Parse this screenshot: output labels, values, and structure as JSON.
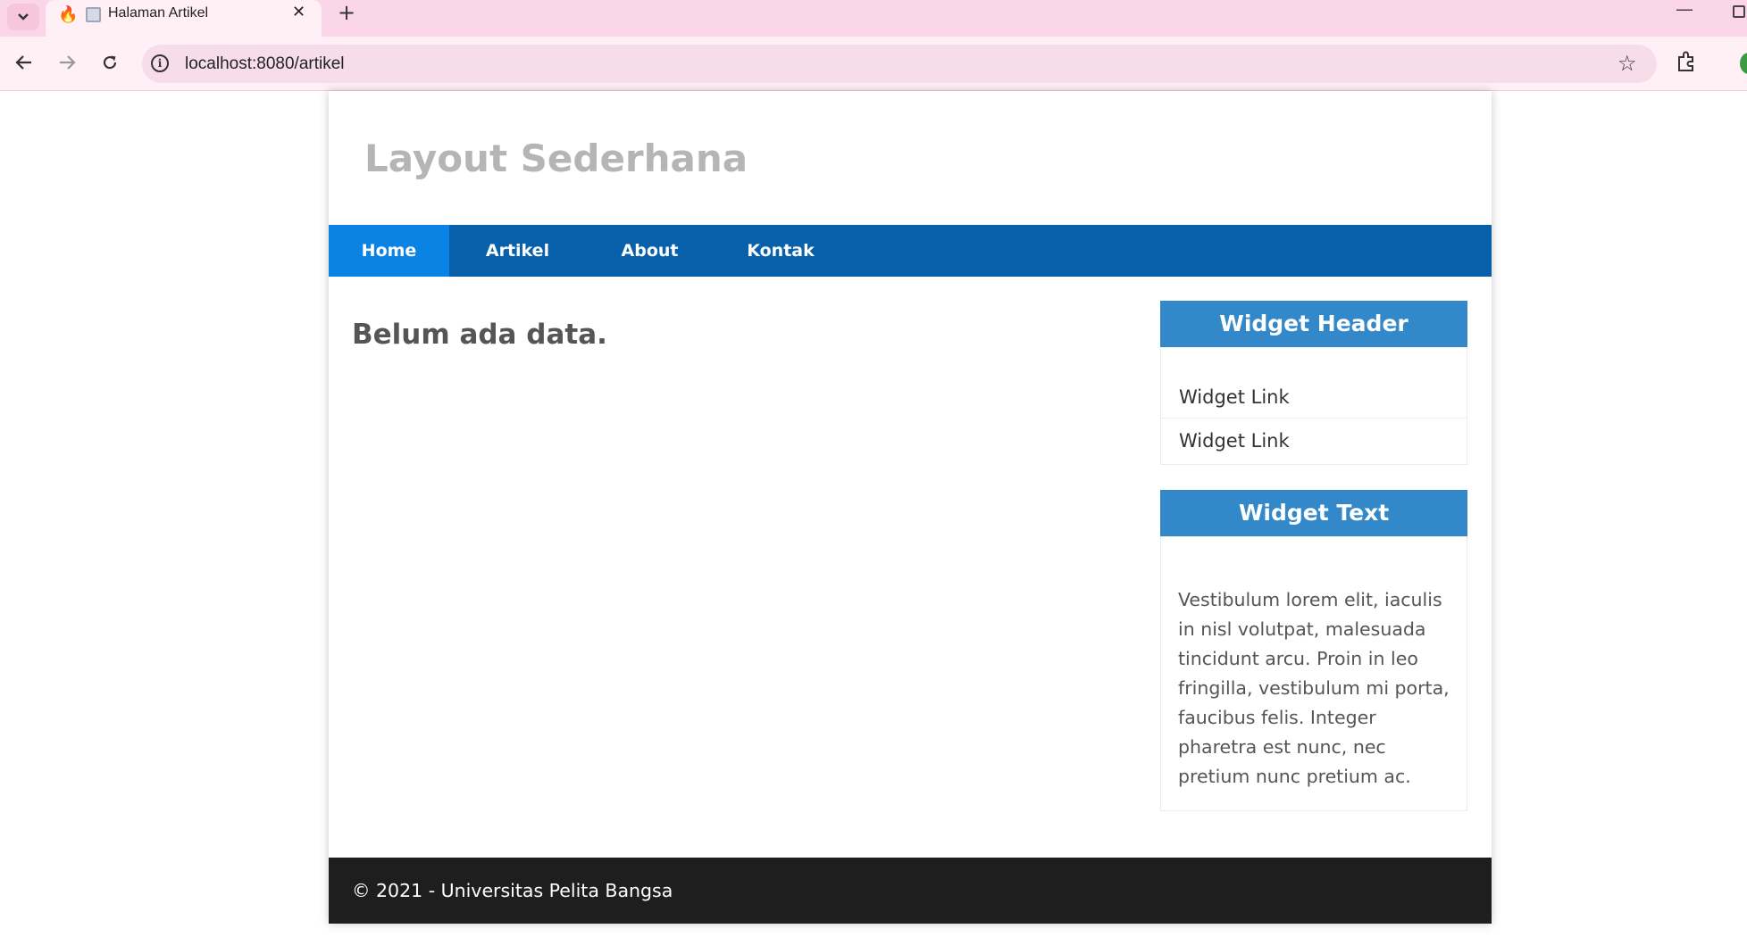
{
  "browser": {
    "tab_title": "Halaman Artikel",
    "tab_close": "✕",
    "new_tab": "+",
    "url": "localhost:8080/artikel"
  },
  "icons": {
    "tab_list": "chevron-down-icon",
    "favicon_app": "flame-icon",
    "favicon_page": "page-icon",
    "back": "arrow-left-icon",
    "forward": "arrow-right-icon",
    "reload": "reload-icon",
    "site_info": "info-icon",
    "bookmark": "star-icon",
    "extensions": "puzzle-icon"
  },
  "header": {
    "title": "Layout Sederhana"
  },
  "nav": {
    "items": [
      {
        "label": "Home",
        "active": true
      },
      {
        "label": "Artikel",
        "active": false
      },
      {
        "label": "About",
        "active": false
      },
      {
        "label": "Kontak",
        "active": false
      }
    ]
  },
  "main": {
    "heading": "Belum ada data."
  },
  "sidebar": {
    "widgets": [
      {
        "title": "Widget Header",
        "links": [
          "Widget Link",
          "Widget Link"
        ]
      },
      {
        "title": "Widget Text",
        "text": "Vestibulum lorem elit, iaculis in nisl volutpat, malesuada tincidunt arcu. Proin in leo fringilla, vestibulum mi porta, faucibus felis. Integer pharetra est nunc, nec pretium nunc pretium ac."
      }
    ]
  },
  "footer": {
    "text": "© 2021 - Universitas Pelita Bangsa"
  },
  "colors": {
    "navbar": "#0760a9",
    "nav_active": "#0a83e5",
    "widget_header": "#3288c8",
    "footer": "#1e1e1e",
    "site_title": "#b5b5b5",
    "browser_frame": "#fbd6e8"
  }
}
